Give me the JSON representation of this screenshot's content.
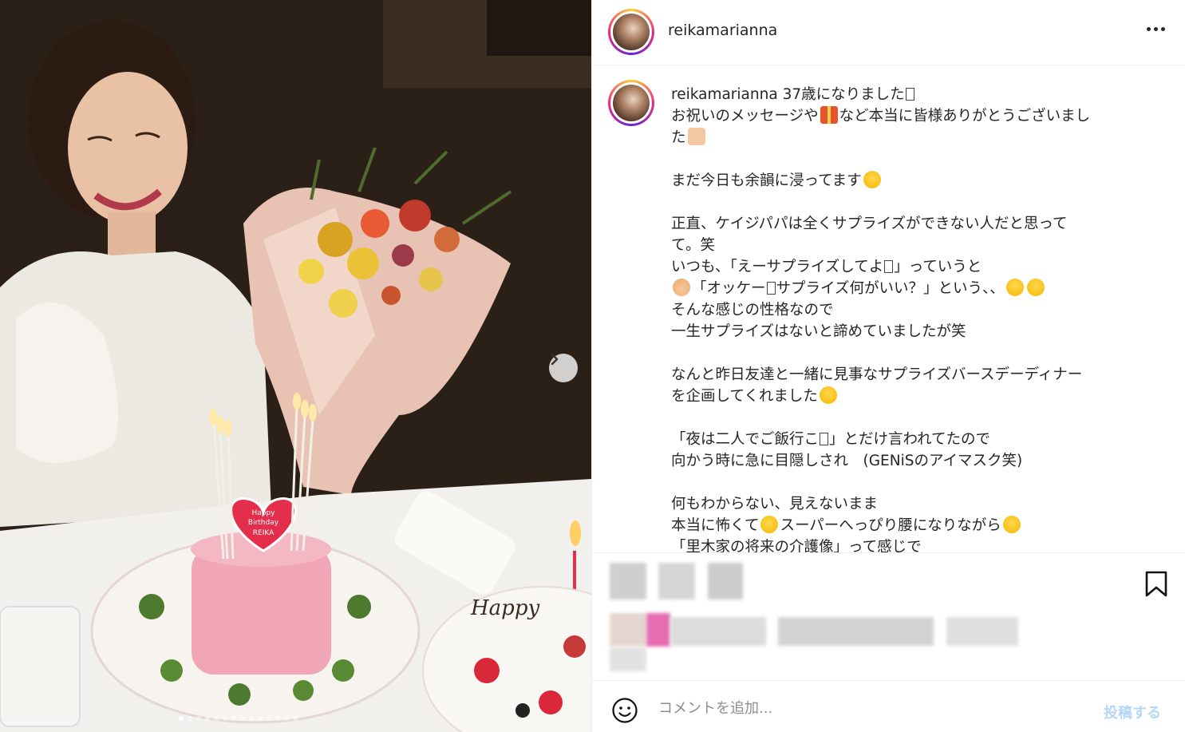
{
  "post": {
    "username": "reikamarianna",
    "avatar_icon": "profile-avatar",
    "more_icon": "more-horizontal-icon"
  },
  "caption": {
    "username": "reikamarianna",
    "lines": [
      {
        "text": "37歳になりました",
        "tail_box": true
      },
      {
        "text": "お祝いのメッセージや",
        "emoji": "gift",
        "after": "など本当に皆様ありがとうございまし"
      },
      {
        "text": "た",
        "emoji_end": "pray"
      },
      {
        "text": ""
      },
      {
        "text": "まだ今日も余韻に浸ってます",
        "emoji_end": "cry"
      },
      {
        "text": ""
      },
      {
        "text": "正直、ケイジパパは全くサプライズができない人だと思って"
      },
      {
        "text": "て。笑"
      },
      {
        "text": "いつも、「えーサプライズしてよ",
        "box_mid": true,
        "after": "」っていうと"
      },
      {
        "text": "「オッケー",
        "emoji_start": "man",
        "box_mid": true,
        "after": "サプライズ何がいい？」という、、",
        "emoji_end2": "laugh"
      },
      {
        "text": "そんな感じの性格なので"
      },
      {
        "text": "一生サプライズはないと諦めていましたが笑"
      },
      {
        "text": ""
      },
      {
        "text": "なんと昨日友達と一緒に見事なサプライズバースデーディナー"
      },
      {
        "text": "を企画してくれました",
        "emoji_end": "cry"
      },
      {
        "text": ""
      },
      {
        "text": "「夜は二人でご飯行こ",
        "box_mid": true,
        "after": "」とだけ言われてたので"
      },
      {
        "text": "向かう時に急に目隠しされ　(GENiSのアイマスク笑)"
      },
      {
        "text": ""
      },
      {
        "text": "何もわからない、見えないまま"
      },
      {
        "text": "本当に怖くて",
        "emoji": "rofl",
        "after": "スーパーへっぴり腰になりながら",
        "emoji_end": "laugh"
      },
      {
        "text": "「里木家の将来の介護像」って感じで"
      }
    ]
  },
  "comment": {
    "placeholder": "コメントを追加...",
    "post_label": "投稿する",
    "emoji_icon": "smiley-icon"
  },
  "photo": {
    "cake_text_1": "Happy",
    "cake_text_2": "Birthday",
    "cake_text_3": "REIKA",
    "plate_text": "Happy",
    "carousel_total": 14,
    "carousel_active": 1
  }
}
